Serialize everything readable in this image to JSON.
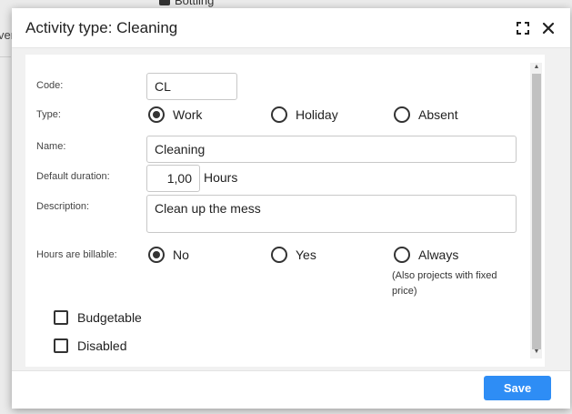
{
  "background": {
    "top_item_label": "Bottling",
    "left_fragment": "ver"
  },
  "dialog": {
    "title": "Activity type: Cleaning"
  },
  "form": {
    "code": {
      "label": "Code:",
      "value": "CL"
    },
    "type": {
      "label": "Type:",
      "options": [
        {
          "label": "Work",
          "selected": true
        },
        {
          "label": "Holiday",
          "selected": false
        },
        {
          "label": "Absent",
          "selected": false
        }
      ]
    },
    "name": {
      "label": "Name:",
      "value": "Cleaning"
    },
    "default_duration": {
      "label": "Default duration:",
      "value": "1,00",
      "unit": "Hours"
    },
    "description": {
      "label": "Description:",
      "value": "Clean up the mess"
    },
    "billable": {
      "label": "Hours are billable:",
      "options": [
        {
          "label": "No",
          "selected": true
        },
        {
          "label": "Yes",
          "selected": false
        },
        {
          "label": "Always",
          "selected": false
        }
      ],
      "note": "(Also projects with fixed price)"
    },
    "budgetable": {
      "label": "Budgetable",
      "checked": false
    },
    "disabled": {
      "label": "Disabled",
      "checked": false
    }
  },
  "footer": {
    "save_label": "Save"
  },
  "colors": {
    "primary_button": "#2e8df5"
  }
}
